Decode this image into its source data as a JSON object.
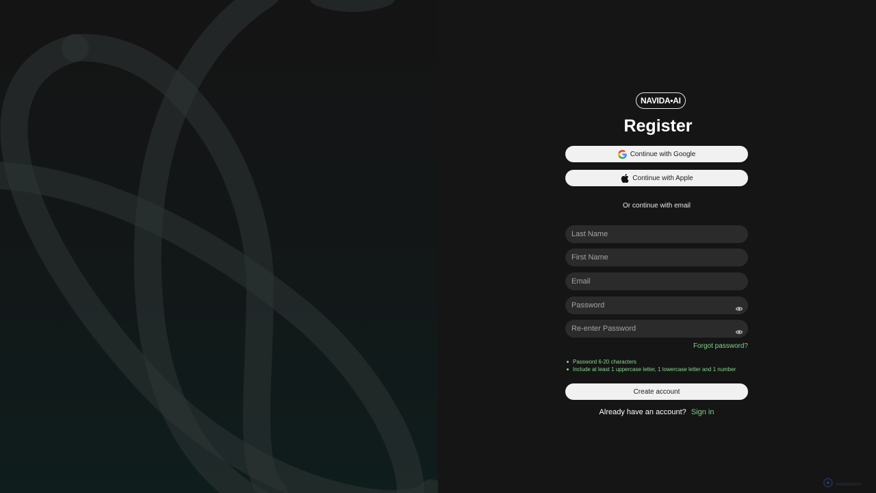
{
  "brand": {
    "logo_text": "NAVIDA•AI"
  },
  "page": {
    "title": "Register"
  },
  "oauth": {
    "google_label": "Continue with Google",
    "apple_label": "Continue with Apple"
  },
  "divider": {
    "text": "Or continue with email"
  },
  "fields": {
    "last_name_placeholder": "Last Name",
    "first_name_placeholder": "First Name",
    "email_placeholder": "Email",
    "password_placeholder": "Password",
    "reenter_password_placeholder": "Re-enter Password"
  },
  "links": {
    "forgot_password": "Forgot password?"
  },
  "password_rules": [
    "Password 6-20 characters",
    "Include at least 1 uppercase letter, 1 lowercase letter and 1 number"
  ],
  "actions": {
    "create_account_label": "Create account"
  },
  "signin": {
    "prompt": "Already have an account?",
    "link_label": "Sign in"
  },
  "icons": {
    "google": "google-logo-icon",
    "apple": "apple-logo-icon",
    "eye": "eye-icon",
    "corner": "corner-badge-icon"
  },
  "colors": {
    "accent_green": "#7fd38b",
    "button_bg": "#f1f1f1",
    "field_bg": "#2b2b2b",
    "page_bg": "#151515"
  }
}
